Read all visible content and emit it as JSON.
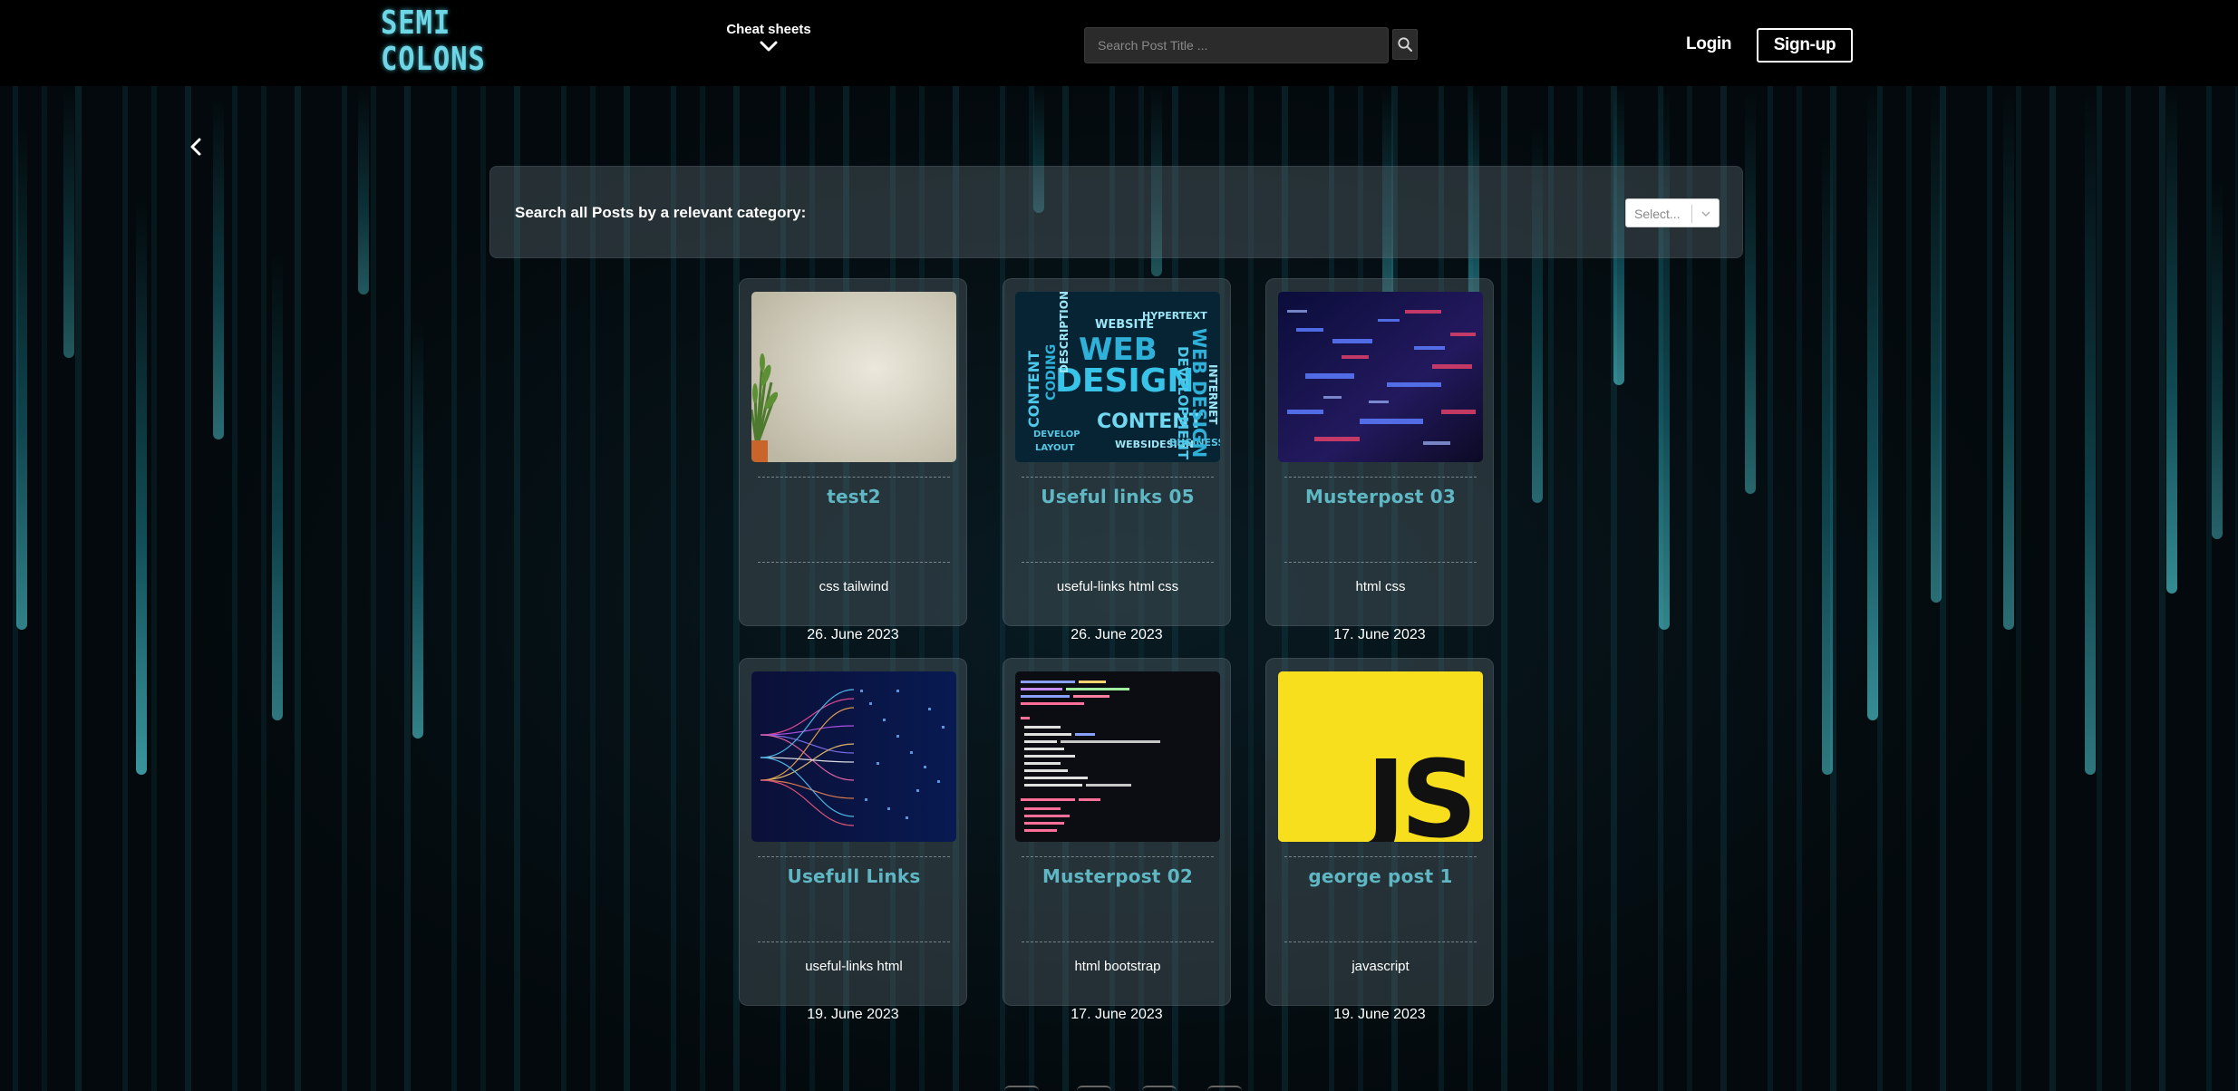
{
  "header": {
    "logo_line1": "SEMI",
    "logo_line2": "COLONS",
    "nav_cheatsheets": "Cheat sheets",
    "search_placeholder": "Search Post Title ...",
    "login": "Login",
    "signup": "Sign-up"
  },
  "filter": {
    "label": "Search all Posts by a relevant category:",
    "select_value": "Select..."
  },
  "posts": [
    {
      "title": "test2",
      "tags": "css tailwind",
      "date": "26. June 2023",
      "image": "plant-on-wall-image"
    },
    {
      "title": "Useful links 05",
      "tags": "useful-links html css",
      "date": "26. June 2023",
      "image": "web-design-wordcloud-image"
    },
    {
      "title": "Musterpost 03",
      "tags": "html css",
      "date": "17. June 2023",
      "image": "digital-data-image"
    },
    {
      "title": "Usefull Links",
      "tags": "useful-links html",
      "date": "19. June 2023",
      "image": "neural-lines-image"
    },
    {
      "title": "Musterpost 02",
      "tags": "html bootstrap",
      "date": "17. June 2023",
      "image": "code-editor-image"
    },
    {
      "title": "george post 1",
      "tags": "javascript",
      "date": "19. June 2023",
      "image": "javascript-logo-image"
    }
  ],
  "js_logo_text": "JS",
  "colors": {
    "accent": "#5fb7c4",
    "header_bg": "#000000",
    "js_yellow": "#f7df1e"
  }
}
